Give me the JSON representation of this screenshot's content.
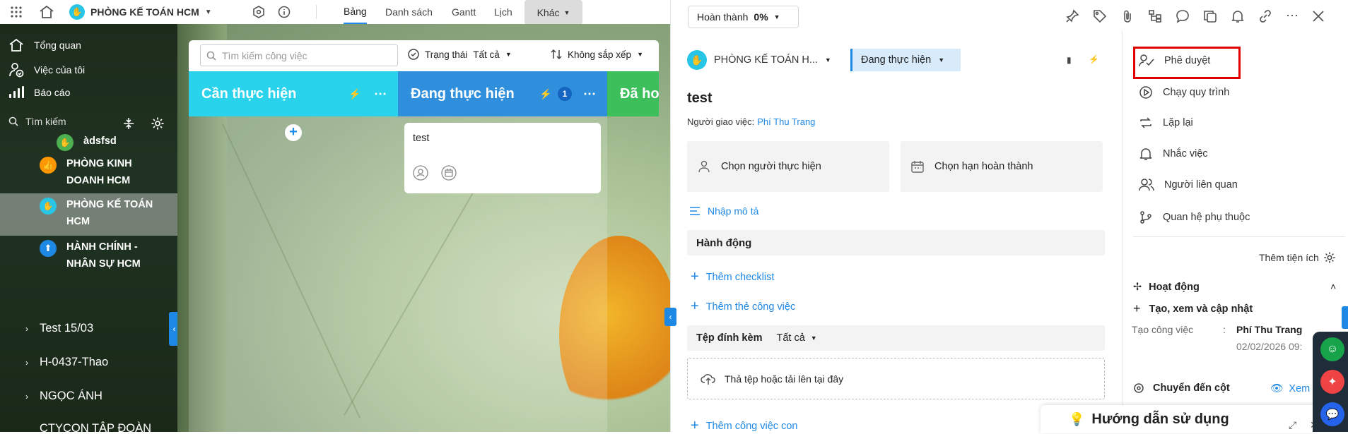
{
  "topbar": {
    "dept_name": "PHÒNG KẾ TOÁN HCM",
    "tabs": [
      {
        "label": "Bảng",
        "active": true
      },
      {
        "label": "Danh sách",
        "active": false
      },
      {
        "label": "Gantt",
        "active": false
      },
      {
        "label": "Lịch",
        "active": false
      }
    ],
    "more_label": "Khác"
  },
  "sidebar": {
    "nav": [
      {
        "label": "Tổng quan",
        "icon": "home-icon"
      },
      {
        "label": "Việc của tôi",
        "icon": "user-tasks-icon"
      },
      {
        "label": "Báo cáo",
        "icon": "chart-icon"
      }
    ],
    "search_placeholder": "Tìm kiếm",
    "projects": [
      {
        "name": "àdsfsd",
        "color": "#4caf50",
        "icon": "hand-icon"
      },
      {
        "name": "PHÒNG KINH DOANH HCM",
        "color": "#ff9800",
        "icon": "thumbs-up-icon"
      },
      {
        "name": "PHÒNG KẾ TOÁN HCM",
        "color": "#29c5e6",
        "icon": "hand-icon",
        "selected": true
      },
      {
        "name": "HÀNH CHÍNH - NHÂN SỰ HCM",
        "color": "#1e88e5",
        "icon": "upload-icon"
      }
    ],
    "groups": [
      "Test 15/03",
      "H-0437-Thao",
      "NGỌC ÁNH",
      "CTYCON TẬP ĐOÀN"
    ]
  },
  "board": {
    "search_placeholder": "Tìm kiếm công việc",
    "status_label": "Trạng thái",
    "status_value": "Tất cả",
    "sort_label": "Không sắp xếp",
    "columns": [
      {
        "title": "Cần thực hiện",
        "color": "#29d3ec",
        "count": ""
      },
      {
        "title": "Đang thực hiện",
        "color": "#2f8fdc",
        "count": "1"
      },
      {
        "title": "Đã ho",
        "color": "#3dbf5c",
        "count": ""
      }
    ],
    "card": {
      "title": "test"
    }
  },
  "panel": {
    "complete_label": "Hoàn thành",
    "complete_percent": "0%",
    "dept_name": "PHÒNG KẾ TOÁN H...",
    "status": "Đang thực hiện",
    "task_title": "test",
    "assigner_label": "Người giao việc:",
    "assigner_name": "Phí Thu Trang",
    "choose_assignee": "Chọn người thực hiện",
    "choose_deadline": "Chọn hạn hoàn thành",
    "enter_description": "Nhập mô tả",
    "actions_header": "Hành động",
    "add_checklist": "Thêm checklist",
    "add_tag": "Thêm thẻ công việc",
    "attachments_label": "Tệp đính kèm",
    "attachments_filter": "Tất cả",
    "drop_zone": "Thả tệp hoặc tải lên tại đây",
    "add_subtask": "Thêm công việc con"
  },
  "actions_side": {
    "items": [
      {
        "label": "Phê duyệt",
        "icon": "approve-icon",
        "highlighted": true
      },
      {
        "label": "Chạy quy trình",
        "icon": "play-icon"
      },
      {
        "label": "Lặp lại",
        "icon": "repeat-icon"
      },
      {
        "label": "Nhắc việc",
        "icon": "bell-icon"
      },
      {
        "label": "Người liên quan",
        "icon": "people-icon"
      },
      {
        "label": "Quan hệ phụ thuộc",
        "icon": "branch-icon"
      }
    ],
    "add_utility": "Thêm tiện ích",
    "activity_title": "Hoạt động",
    "create_view_update": "Tạo, xem và cập nhật",
    "log_label": "Tạo công việc",
    "log_sep": ":",
    "log_user": "Phí Thu Trang",
    "log_time": "02/02/2026 09:",
    "move_column": "Chuyển đến cột",
    "view_label": "Xem"
  },
  "guide": {
    "title": "Hướng dẫn sử dụng"
  },
  "colors": {
    "accent": "#1e88e5",
    "highlight_border": "#e00000"
  }
}
